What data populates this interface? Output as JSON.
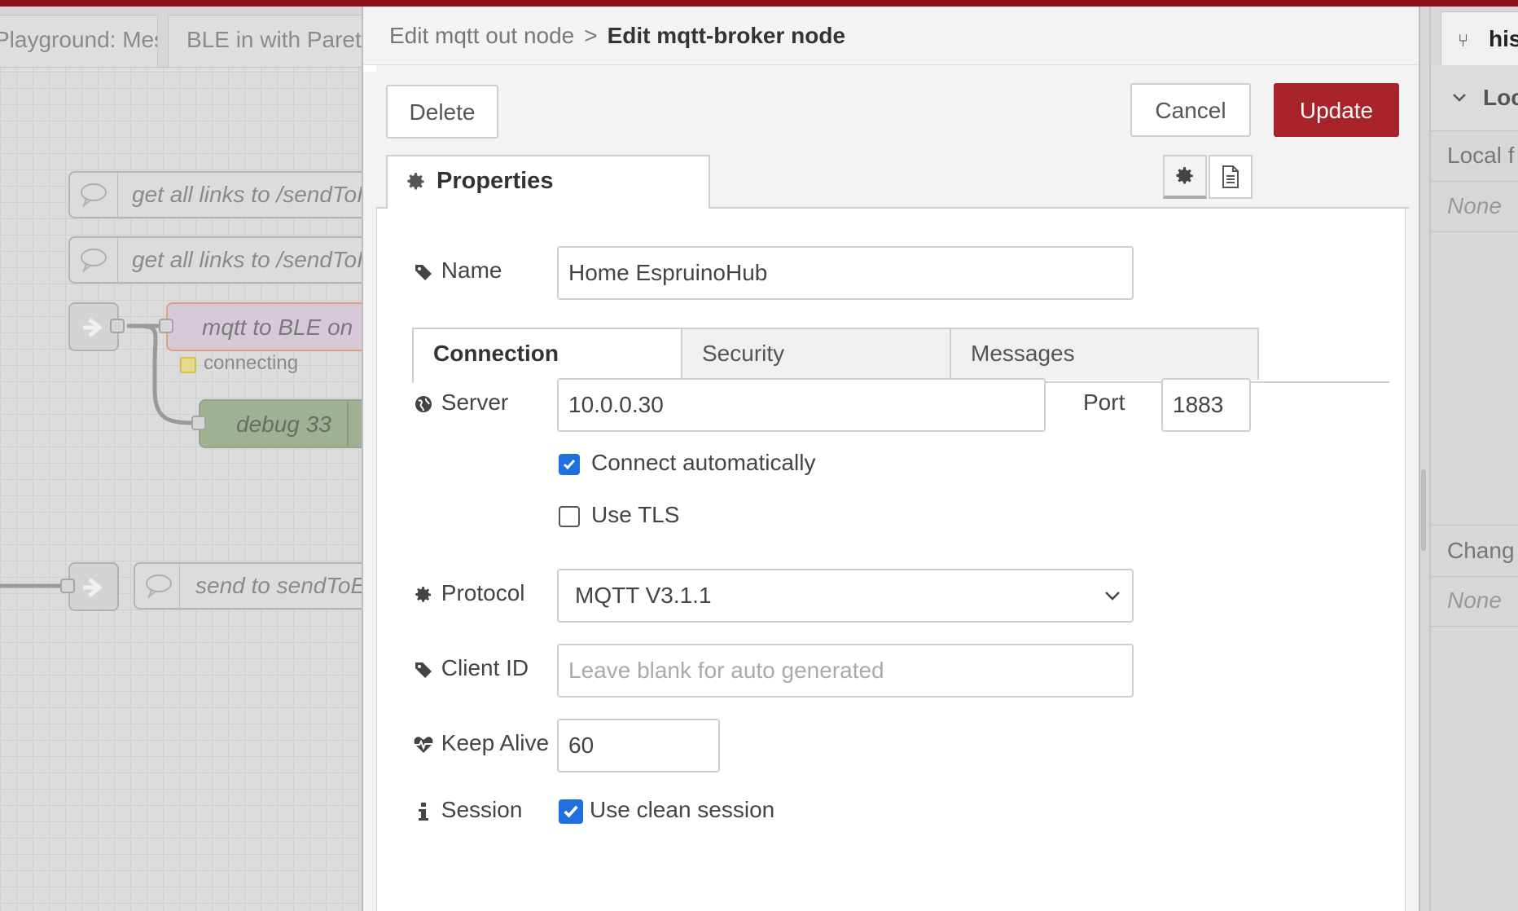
{
  "workspace": {
    "flow_tabs": [
      "Playground: Mes",
      "BLE in with Paret"
    ],
    "comments": [
      "get all links to /sendToI",
      "get all links to /sendToI",
      "send to sendToE"
    ],
    "mqtt_node_label": "mqtt to BLE on",
    "mqtt_node_status": "connecting",
    "debug_node_label": "debug 33"
  },
  "breadcrumb": {
    "previous": "Edit mqtt out node",
    "separator": ">",
    "current": "Edit mqtt-broker node"
  },
  "actions": {
    "delete_label": "Delete",
    "cancel_label": "Cancel",
    "update_label": "Update"
  },
  "properties_tab": {
    "label": "Properties",
    "settings_icon": "gear-icon",
    "description_icon": "file-text-icon"
  },
  "form": {
    "name": {
      "label": "Name",
      "value": "Home EspruinoHub"
    },
    "tabs": [
      "Connection",
      "Security",
      "Messages"
    ],
    "server": {
      "label": "Server",
      "value": "10.0.0.30"
    },
    "port": {
      "label": "Port",
      "value": "1883"
    },
    "connect_automatically": {
      "label": "Connect automatically",
      "checked": true
    },
    "use_tls": {
      "label": "Use TLS",
      "checked": false
    },
    "protocol": {
      "label": "Protocol",
      "value": "MQTT V3.1.1"
    },
    "client_id": {
      "label": "Client ID",
      "value": "",
      "placeholder": "Leave blank for auto generated"
    },
    "keep_alive": {
      "label": "Keep Alive",
      "value": "60"
    },
    "session": {
      "label": "Session",
      "checkbox_label": "Use clean session",
      "checked": true
    }
  },
  "sidebar": {
    "tab_label": "his",
    "section1_title": "Loc",
    "local_label": "Local f",
    "none_1": "None",
    "changes_label": "Chang",
    "none_2": "None"
  },
  "colors": {
    "accent_red": "#a8232a",
    "checkbox_blue": "#1f6fe0",
    "topbar": "#8c101c"
  }
}
